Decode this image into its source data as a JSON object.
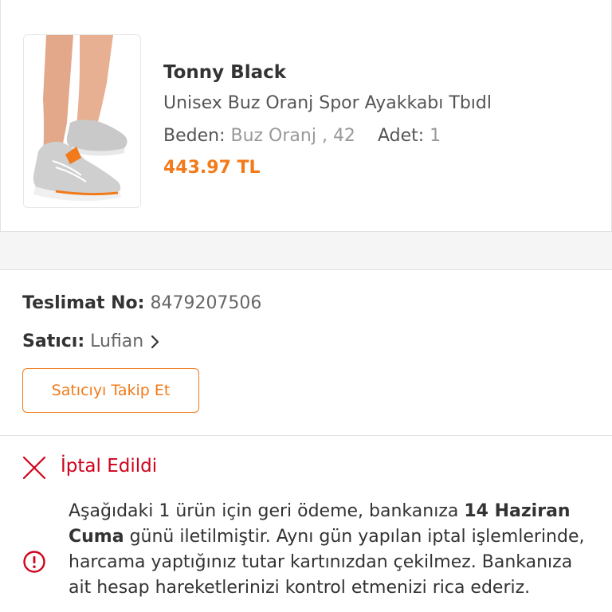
{
  "product": {
    "brand": "Tonny Black",
    "name": "Unisex Buz Oranj Spor Ayakkabı Tbıdl",
    "size_label": "Beden:",
    "size_value": "Buz Oranj , 42",
    "qty_label": "Adet:",
    "qty_value": "1",
    "price": "443.97 TL",
    "image_icon": "sneaker-photo"
  },
  "delivery": {
    "number_label": "Teslimat No:",
    "number_value": "8479207506",
    "seller_label": "Satıcı:",
    "seller_value": "Lufian",
    "follow_button": "Satıcıyı Takip Et"
  },
  "cancel": {
    "status": "İptal Edildi",
    "refund_prefix": "Aşağıdaki 1 ürün için geri ödeme, bankanıza ",
    "refund_date": "14 Haziran Cuma",
    "refund_suffix": " günü iletilmiştir. Aynı gün yapılan iptal işlemlerinde, harcama yaptığınız tutar kartınızdan çekilmez. Bankanıza ait hesap hareketlerinizi kontrol etmenizi rica ederiz."
  },
  "colors": {
    "accent": "#f27a1a",
    "cancel_red": "#d0021b",
    "separator": "#f5f5f5"
  }
}
